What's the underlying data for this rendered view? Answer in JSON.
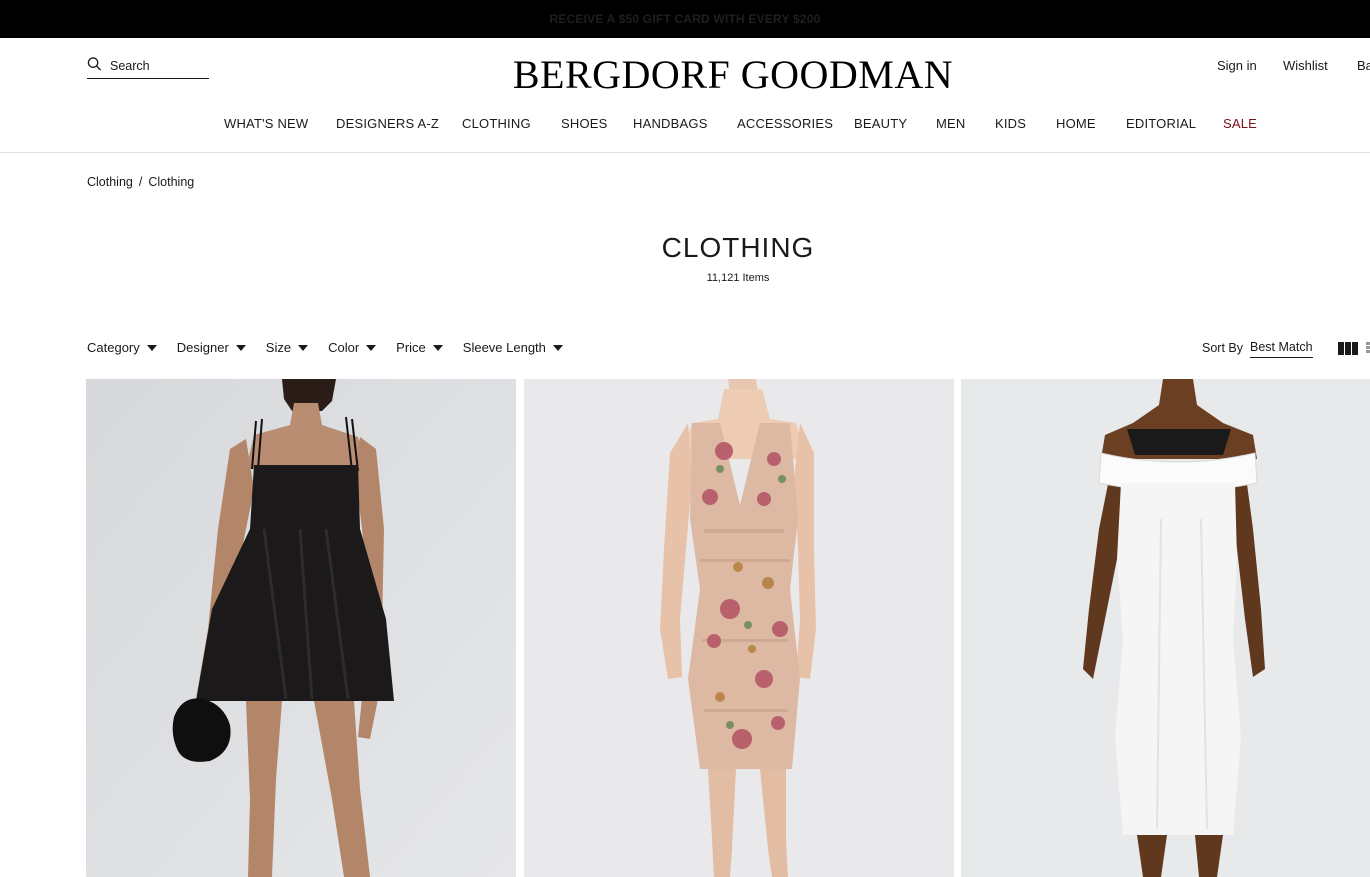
{
  "promo": {
    "text": "RECEIVE A $50 GIFT CARD WITH EVERY $200"
  },
  "header": {
    "search_placeholder": "Search",
    "logo": "BERGDORF GOODMAN",
    "sign_in": "Sign in",
    "wishlist": "Wishlist",
    "bag_partial": "Ba"
  },
  "nav": {
    "items": [
      "WHAT'S NEW",
      "DESIGNERS A-Z",
      "CLOTHING",
      "SHOES",
      "HANDBAGS",
      "ACCESSORIES",
      "BEAUTY",
      "MEN",
      "KIDS",
      "HOME",
      "EDITORIAL",
      "SALE"
    ]
  },
  "breadcrumb": {
    "items": [
      "Clothing",
      "Clothing"
    ],
    "separator": "/"
  },
  "page": {
    "title": "CLOTHING",
    "count": "11,121 Items"
  },
  "filters": [
    "Category",
    "Designer",
    "Size",
    "Color",
    "Price",
    "Sleeve Length"
  ],
  "sort": {
    "label": "Sort By",
    "value": "Best Match"
  },
  "colors": {
    "sale": "#7a0f14",
    "promo_bg": "#000000",
    "product_bg": "#e7e8ea"
  },
  "products": [
    {
      "image": "black-satin-mini-dress-image"
    },
    {
      "image": "floral-sequin-sheath-dress-image"
    },
    {
      "image": "white-off-shoulder-midi-dress-image"
    }
  ]
}
